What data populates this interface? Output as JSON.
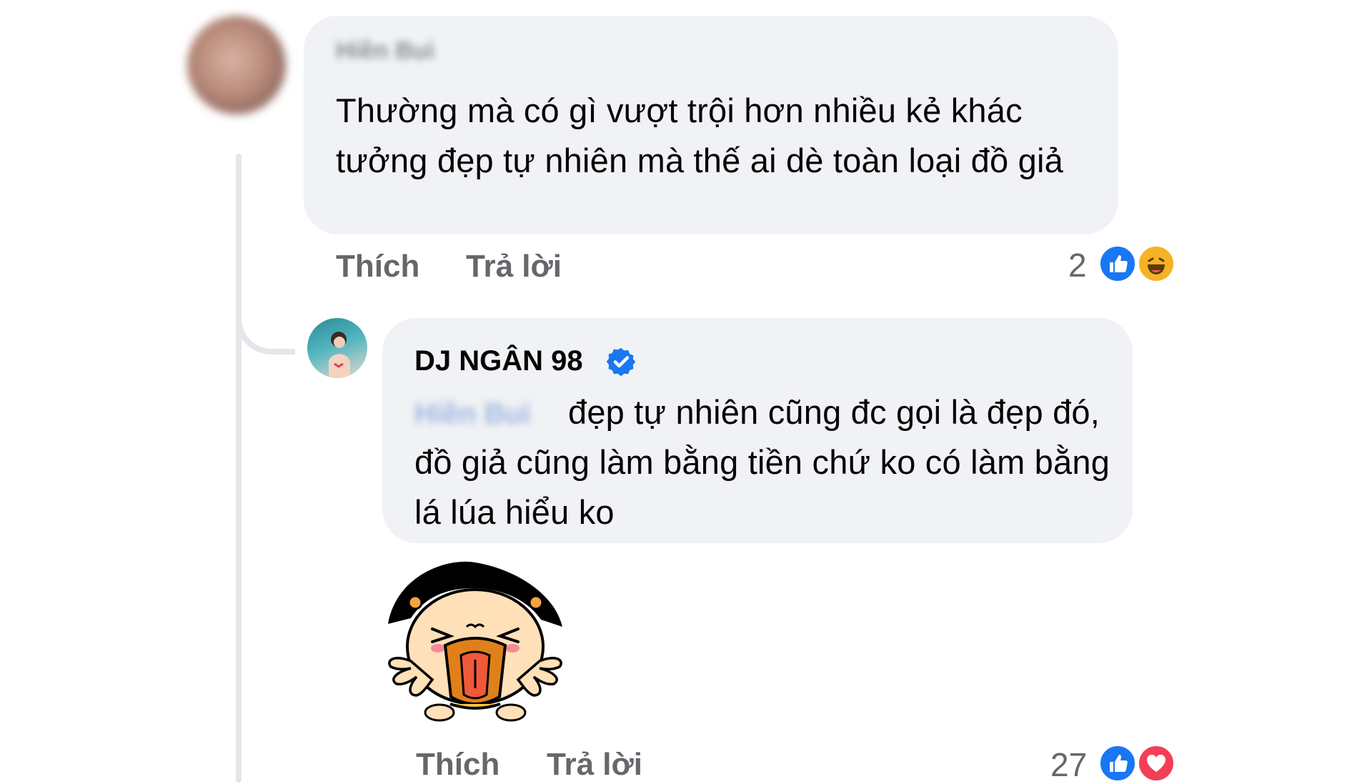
{
  "comment1": {
    "author_blurred": "Hiền Bui",
    "text": "Thường mà có gì vượt trội hơn nhiều kẻ khác tưởng đẹp tự nhiên mà thế ai dè toàn loại đồ giả",
    "actions": {
      "like": "Thích",
      "reply": "Trả lời"
    },
    "reaction_count": "2",
    "reactions": [
      "like-icon",
      "haha-icon"
    ]
  },
  "comment2": {
    "author": "DJ NGÂN 98",
    "verified": true,
    "mention_blurred": "Hiền Bui",
    "text": "đẹp tự nhiên cũng đc gọi là đẹp đó, đồ giả cũng làm bằng tiền chứ ko có làm bằng lá lúa hiểu ko",
    "sticker": "tongue-out-girl-sticker",
    "actions": {
      "like": "Thích",
      "reply": "Trả lời"
    },
    "reaction_count": "27",
    "reactions": [
      "like-icon",
      "love-icon"
    ]
  },
  "colors": {
    "bubble": "#f0f2f5",
    "like_blue": "#1877f2",
    "verified_blue": "#1877f2",
    "love_red": "#f33e58",
    "haha_yellow": "#f7b125",
    "muted_text": "#65676b"
  }
}
